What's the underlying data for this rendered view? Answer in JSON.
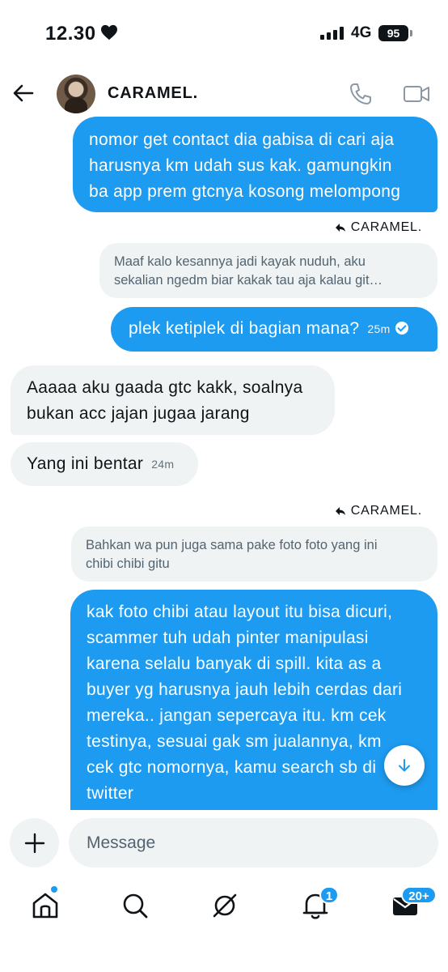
{
  "status_bar": {
    "time": "12.30",
    "network": "4G",
    "battery": "95"
  },
  "header": {
    "contact_name": "CARAMEL."
  },
  "messages": [
    {
      "direction": "out",
      "lines": [
        "nomor get contact dia gabisa di cari aja",
        "harusnya km udah sus kak. gamungkin",
        "ba app prem gtcnya kosong melompong"
      ]
    },
    {
      "reply_to": "CARAMEL.",
      "quote_lines": [
        "Maaf kalo kesannya jadi kayak nuduh, aku",
        "sekalian ngedm biar kakak tau aja kalau git…"
      ]
    },
    {
      "direction": "out",
      "text": "plek ketiplek di bagian mana?",
      "time": "25m"
    },
    {
      "direction": "in",
      "lines": [
        "Aaaaa aku gaada gtc kakk, soalnya",
        "bukan acc jajan jugaa jarang"
      ]
    },
    {
      "direction": "in",
      "text": "Yang ini bentar",
      "time": "24m"
    },
    {
      "reply_to": "CARAMEL.",
      "quote_lines": [
        "Bahkan wa pun juga sama pake foto foto yang ini",
        "chibi chibi gitu"
      ]
    },
    {
      "direction": "out",
      "lines": [
        "kak foto chibi atau layout itu bisa dicuri,",
        "scammer tuh udah pinter manipulasi",
        "karena selalu banyak di spill. kita as a",
        "buyer yg harusnya jauh lebih cerdas dari",
        "mereka.. jangan sepercaya itu. km cek",
        "testinya, sesuai gak sm jualannya, km",
        "cek gtc nomornya, kamu search sb di",
        "twitter"
      ]
    }
  ],
  "composer": {
    "placeholder": "Message"
  },
  "tabbar": {
    "notifications_badge": "1",
    "messages_badge": "20+"
  },
  "colors": {
    "accent": "#1d9bf0",
    "incoming_bubble": "#eff3f4"
  },
  "icons": [
    "heart-icon",
    "signal-icon",
    "battery-icon",
    "back-arrow-icon",
    "phone-icon",
    "video-icon",
    "reply-icon",
    "checkmark-icon",
    "arrow-down-icon",
    "plus-icon",
    "home-icon",
    "search-icon",
    "grok-icon",
    "bell-icon",
    "mail-icon"
  ]
}
